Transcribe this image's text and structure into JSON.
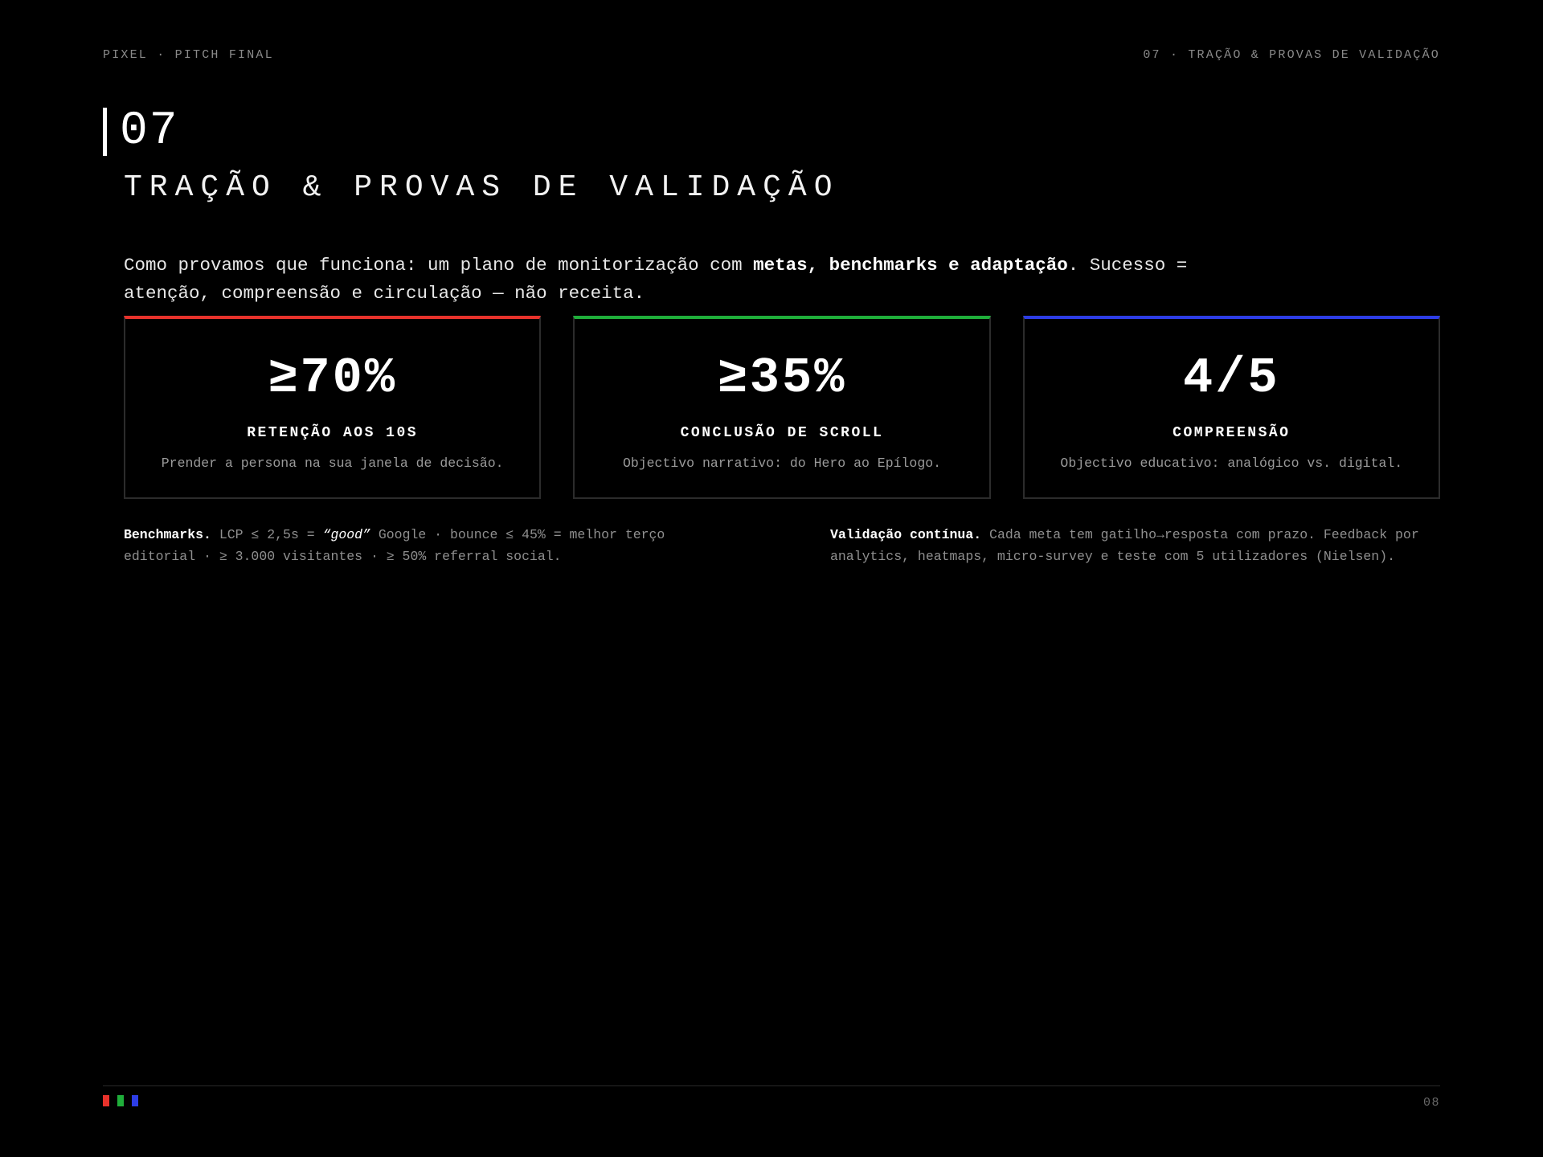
{
  "header": {
    "left": "PIXEL · PITCH FINAL",
    "right": "07 · TRAÇÃO & PROVAS DE VALIDAÇÃO"
  },
  "section": {
    "number": "07",
    "title": "TRAÇÃO & PROVAS DE VALIDAÇÃO"
  },
  "lead": {
    "before": "Como provamos que funciona: um plano de monitorização com ",
    "bold": "metas, benchmarks e adaptação",
    "after": ". Sucesso = atenção, compreensão e circulação — não receita."
  },
  "cards": [
    {
      "value": "≥70%",
      "label": "RETENÇÃO AOS 10S",
      "desc": "Prender a persona na sua janela de decisão.",
      "accent": "#e8322b"
    },
    {
      "value": "≥35%",
      "label": "CONCLUSÃO DE SCROLL",
      "desc": "Objectivo narrativo: do Hero ao Epílogo.",
      "accent": "#1fae3a"
    },
    {
      "value": "4/5",
      "label": "COMPREENSÃO",
      "desc": "Objectivo educativo: analógico vs. digital.",
      "accent": "#2d3de6"
    }
  ],
  "notes": {
    "benchmarks": {
      "title": "Benchmarks.",
      "text1": " LCP ≤ 2,5s = ",
      "italic": "“good”",
      "text2": " Google · bounce ≤ 45% = melhor terço editorial · ≥ 3.000 visitantes · ≥ 50% referral social."
    },
    "validation": {
      "title": "Validação contínua.",
      "text": " Cada meta tem gatilho→resposta com prazo. Feedback por analytics, heatmaps, micro-survey e teste com 5 utilizadores (Nielsen)."
    }
  },
  "footer": {
    "page": "08",
    "swatch_colors": [
      "#e8322b",
      "#1fae3a",
      "#2d3de6"
    ]
  }
}
